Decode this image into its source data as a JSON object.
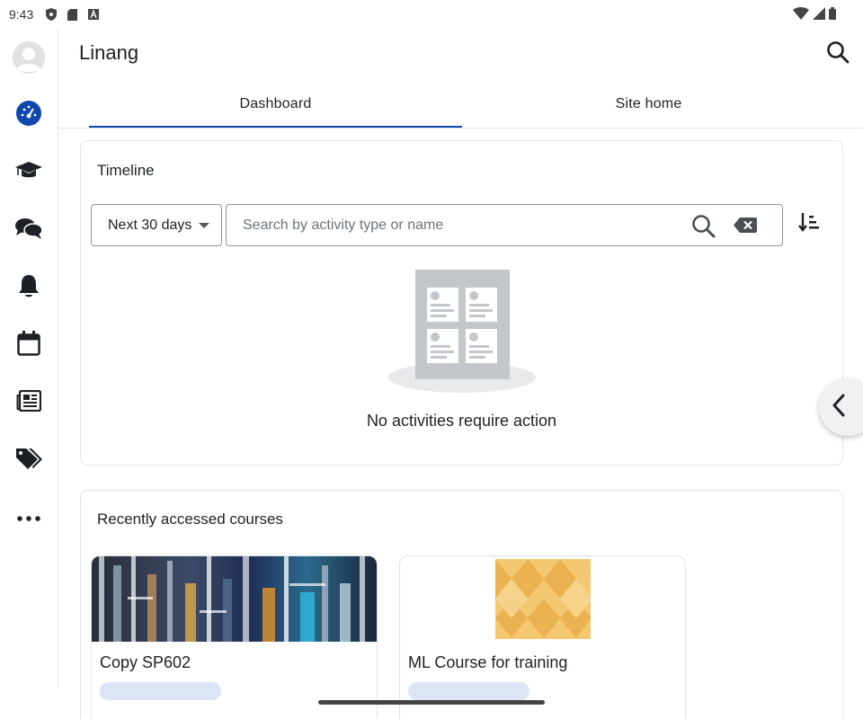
{
  "status_bar": {
    "time": "9:43"
  },
  "app": {
    "title": "Linang"
  },
  "tabs": [
    {
      "label": "Dashboard",
      "active": true
    },
    {
      "label": "Site home",
      "active": false
    }
  ],
  "rail": {
    "items": [
      "avatar",
      "dashboard-icon",
      "graduation-cap-icon",
      "chat-icon",
      "bell-icon",
      "calendar-icon",
      "news-icon",
      "tags-icon",
      "more-icon"
    ],
    "accent": "#0f47ad"
  },
  "timeline": {
    "title": "Timeline",
    "filter_label": "Next 30 days",
    "search_placeholder": "Search by activity type or name",
    "empty_message": "No activities require action"
  },
  "recent": {
    "title": "Recently accessed courses",
    "courses": [
      {
        "name": "Copy SP602"
      },
      {
        "name": "ML Course for training"
      }
    ]
  }
}
